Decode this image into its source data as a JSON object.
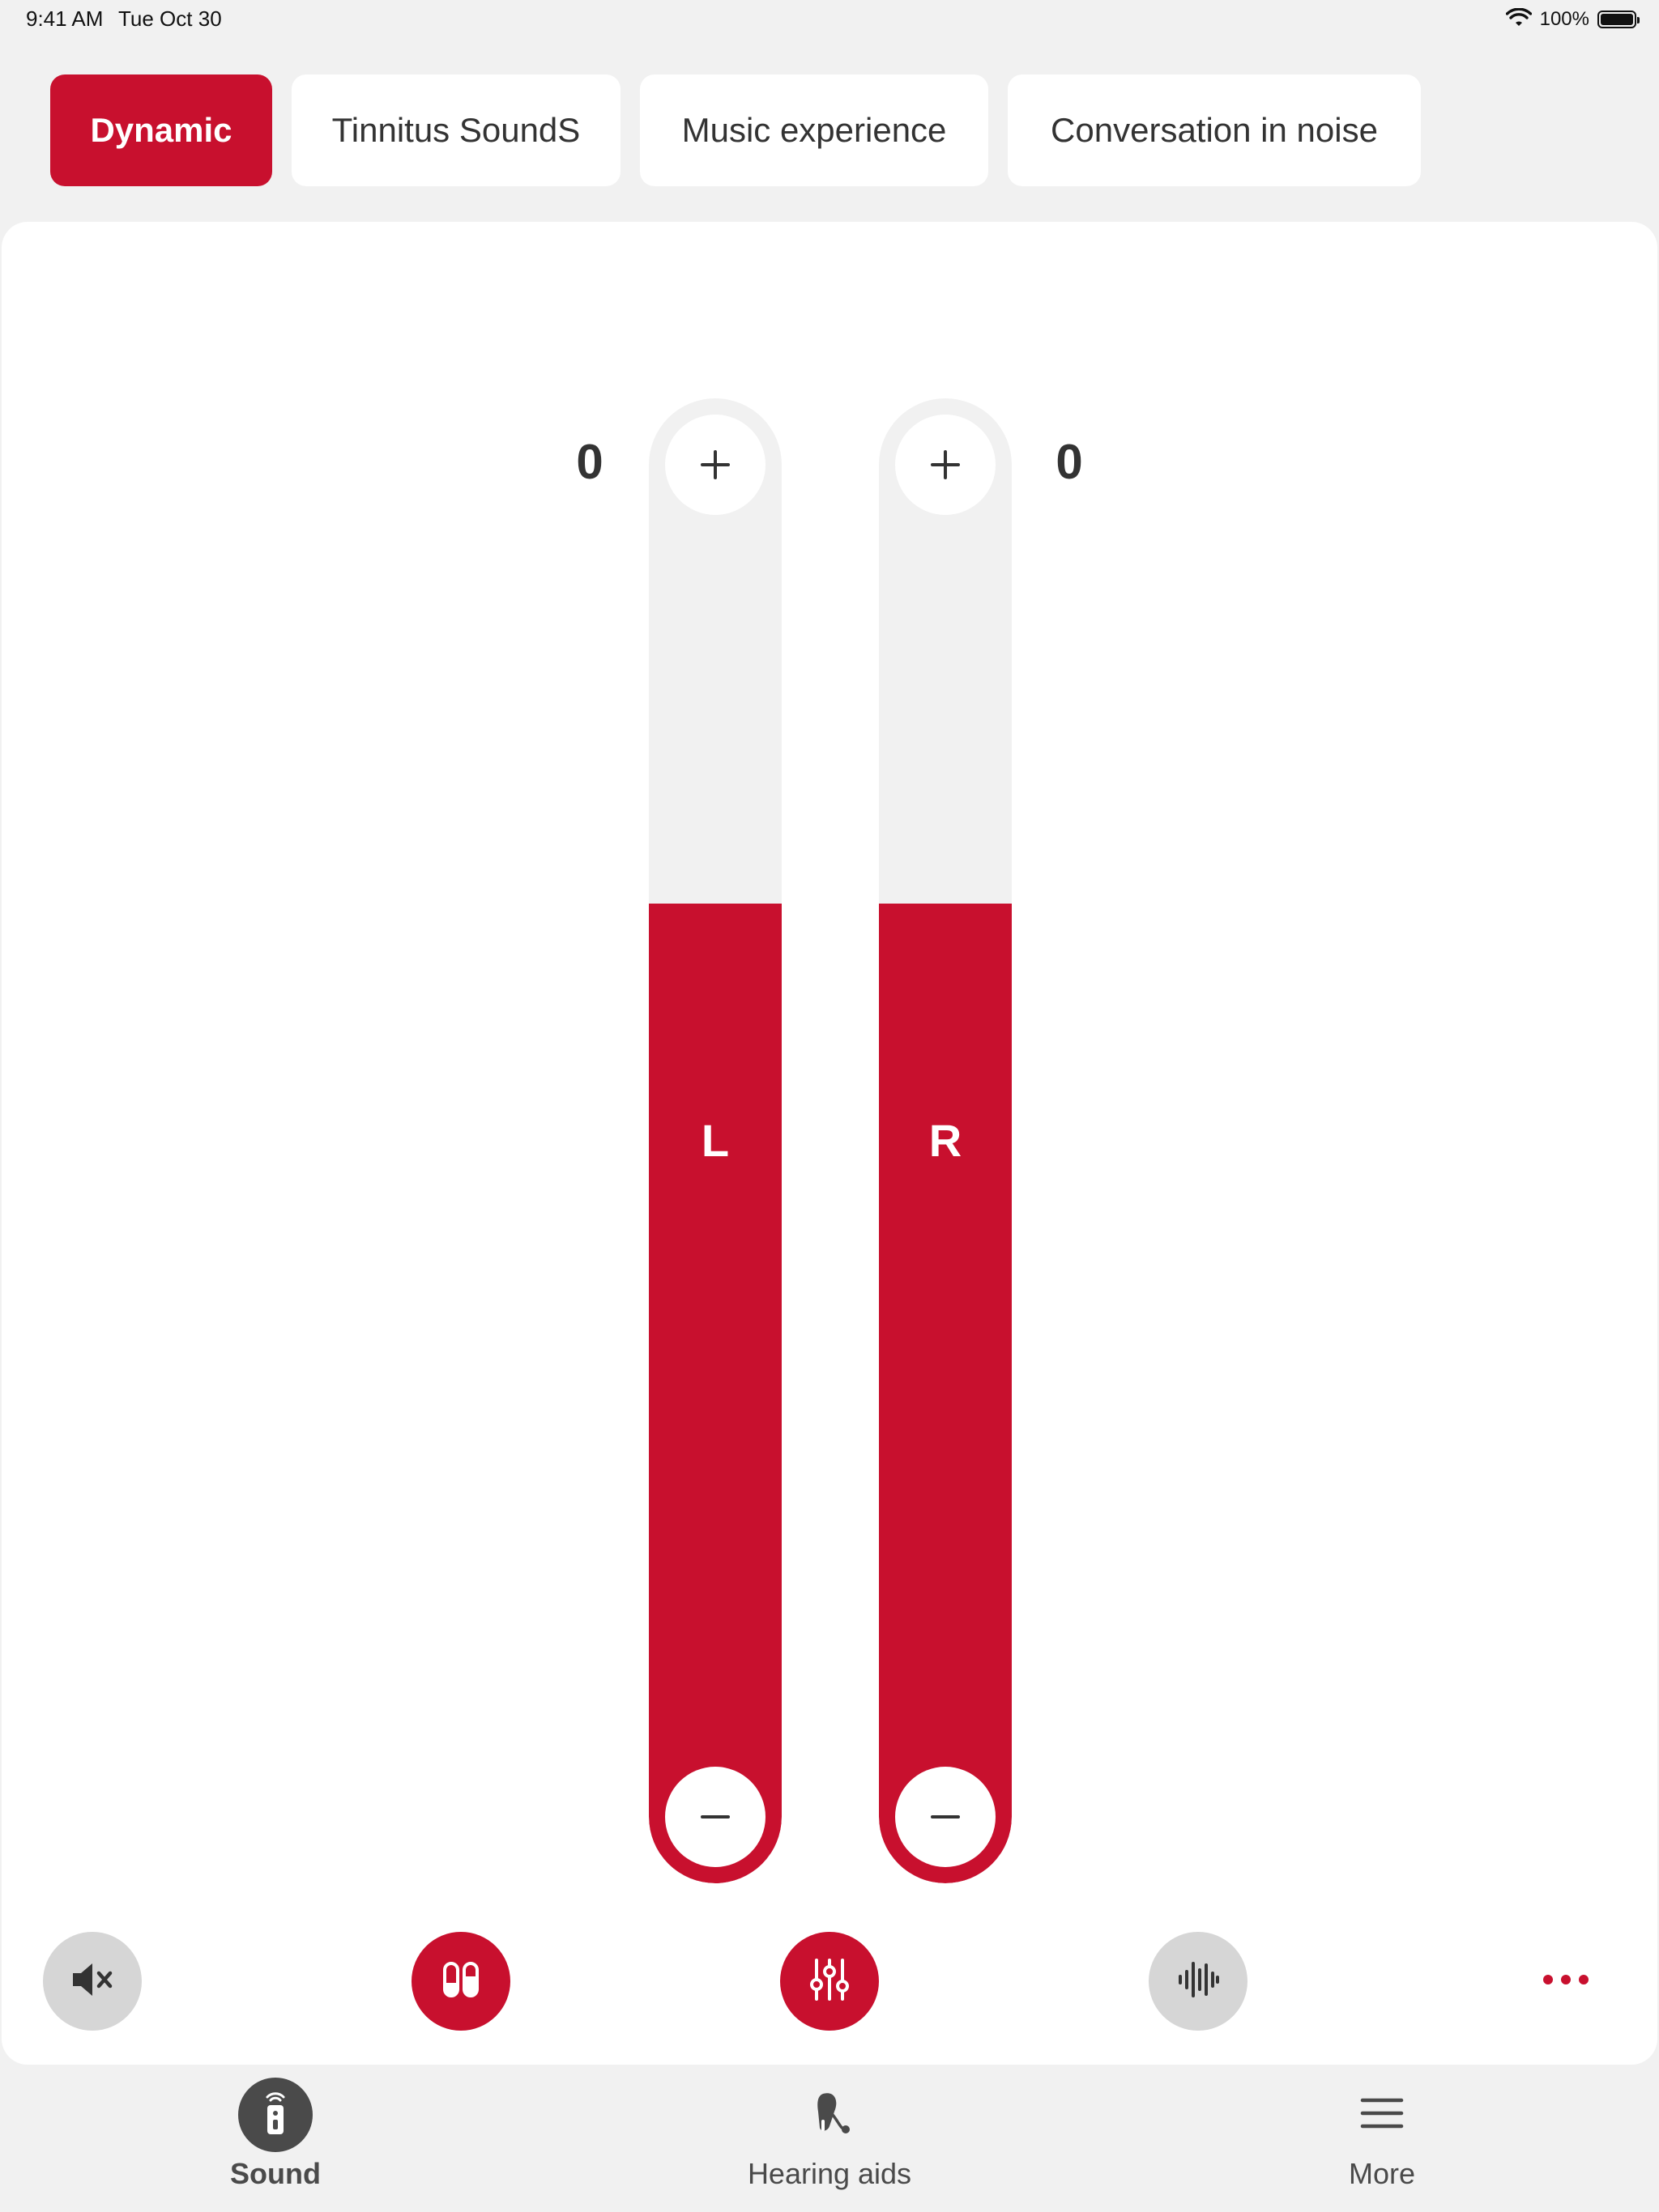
{
  "status_bar": {
    "time": "9:41 AM",
    "date": "Tue Oct 30",
    "battery": "100%"
  },
  "tabs": [
    {
      "label": "Dynamic",
      "active": true
    },
    {
      "label": "Tinnitus SoundS",
      "active": false
    },
    {
      "label": "Music experience",
      "active": false
    },
    {
      "label": "Conversation in noise",
      "active": false
    }
  ],
  "volume": {
    "left": {
      "value": "0",
      "letter": "L",
      "level": 0.66
    },
    "right": {
      "value": "0",
      "letter": "R",
      "level": 0.66
    }
  },
  "actions": [
    {
      "icon": "mute-speaker-icon"
    },
    {
      "icon": "balance-split-icon"
    },
    {
      "icon": "equalizer-sliders-icon"
    },
    {
      "icon": "sound-wave-icon"
    },
    {
      "icon": "more-dots-icon"
    }
  ],
  "nav": {
    "items": [
      {
        "label": "Sound",
        "icon": "remote-control-icon",
        "active": true
      },
      {
        "label": "Hearing aids",
        "icon": "hearing-aid-icon",
        "active": false
      },
      {
        "label": "More",
        "icon": "hamburger-menu-icon",
        "active": false
      }
    ]
  },
  "colors": {
    "accent": "#c8102e",
    "background": "#f1f1f1",
    "card": "#ffffff",
    "text": "#333333",
    "inactive_button": "#d6d6d6"
  }
}
